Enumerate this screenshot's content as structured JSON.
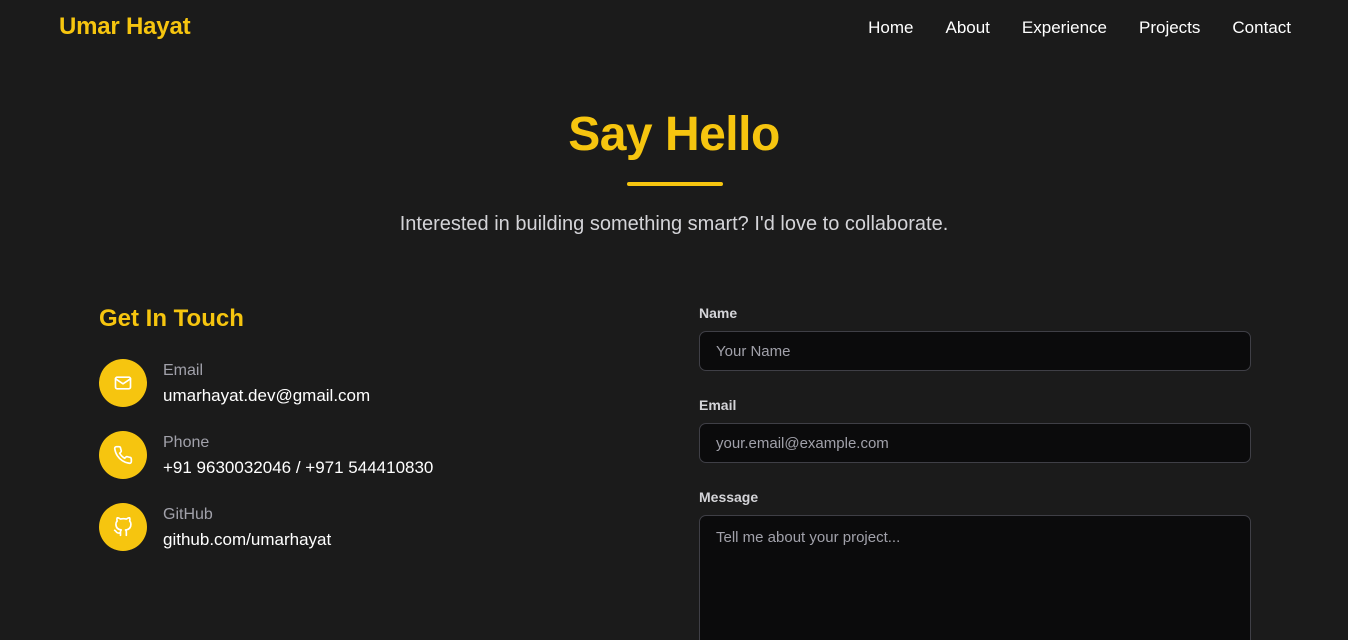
{
  "header": {
    "logo": "Umar Hayat",
    "nav": [
      "Home",
      "About",
      "Experience",
      "Projects",
      "Contact"
    ]
  },
  "hero": {
    "title": "Say Hello",
    "subtitle": "Interested in building something smart? I'd love to collaborate."
  },
  "contact_info": {
    "title": "Get In Touch",
    "items": [
      {
        "icon": "mail-icon",
        "label": "Email",
        "value": "umarhayat.dev@gmail.com"
      },
      {
        "icon": "phone-icon",
        "label": "Phone",
        "value": "+91 9630032046 / +971 544410830"
      },
      {
        "icon": "github-icon",
        "label": "GitHub",
        "value": "github.com/umarhayat"
      }
    ]
  },
  "form": {
    "name_label": "Name",
    "name_placeholder": "Your Name",
    "email_label": "Email",
    "email_placeholder": "your.email@example.com",
    "message_label": "Message",
    "message_placeholder": "Tell me about your project..."
  },
  "colors": {
    "background": "#1b1b1b",
    "accent": "#f6c50f",
    "field_background": "#0b0b0c",
    "field_border": "#3f3f46",
    "muted_text": "#a1a1aa"
  }
}
